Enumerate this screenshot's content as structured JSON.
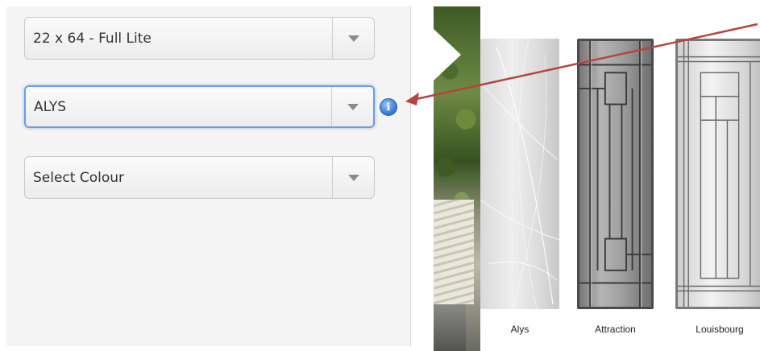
{
  "form": {
    "size_select": {
      "value": "22 x 64 - Full Lite"
    },
    "glass_select": {
      "value": "ALYS"
    },
    "colour_select": {
      "value": "Select Colour"
    }
  },
  "glass_gallery": {
    "items": [
      {
        "caption": "Alys"
      },
      {
        "caption": "Attraction"
      },
      {
        "caption": "Louisbourg"
      }
    ]
  },
  "colors": {
    "focus_border": "#6f9be6",
    "info_icon": "#3c7fd6",
    "pointer_arrow": "#b5433f"
  },
  "icons": {
    "info": "info-icon",
    "dropdown": "chevron-down-icon"
  }
}
